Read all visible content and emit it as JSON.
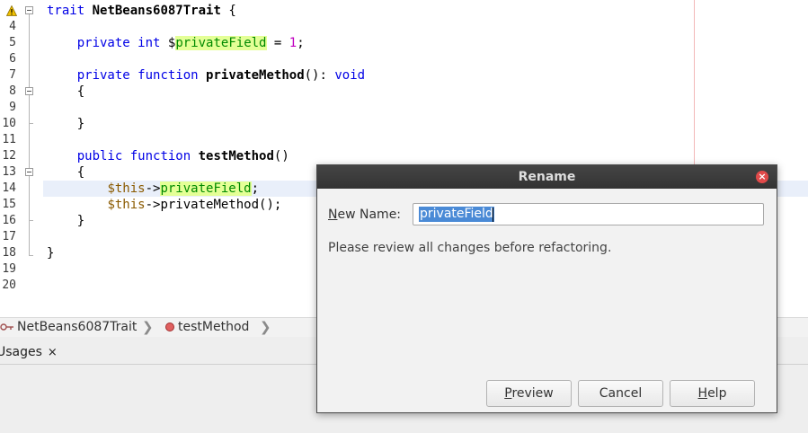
{
  "editor": {
    "line_numbers": [
      "4",
      "5",
      "6",
      "7",
      "8",
      "9",
      "10",
      "11",
      "12",
      "13",
      "14",
      "15",
      "16",
      "17",
      "18",
      "19",
      "20"
    ],
    "code": {
      "l4_kw": "trait",
      "l4_name": "NetBeans6087Trait",
      "l4_brace": "{",
      "l5_private": "private",
      "l5_int": "int",
      "l5_dollar": "$",
      "l5_field": "privateField",
      "l5_eq": " = ",
      "l5_num": "1",
      "l5_semi": ";",
      "l7_private": "private",
      "l7_function": "function",
      "l7_name": "privateMethod",
      "l7_sig": "(): ",
      "l7_void": "void",
      "l8_brace": "{",
      "l10_brace": "}",
      "l12_public": "public",
      "l12_function": "function",
      "l12_name": "testMethod",
      "l12_parens": "()",
      "l13_brace": "{",
      "l14_this": "$this",
      "l14_arrow": "->",
      "l14_field": "privateField",
      "l14_semi": ";",
      "l15_this": "$this",
      "l15_call": "->privateMethod();",
      "l16_brace": "}",
      "l18_brace": "}"
    }
  },
  "breadcrumb": {
    "trait": "NetBeans6087Trait",
    "method": "testMethod",
    "sep": "❯"
  },
  "bottom_panel": {
    "tab_label": "Usages",
    "tab_close": "×"
  },
  "dialog": {
    "title": "Rename",
    "close_glyph": "×",
    "new_name_label_mnemonic": "N",
    "new_name_label_rest": "ew Name:",
    "new_name_value": "privateField",
    "review_text": "Please review all changes before refactoring.",
    "preview_mnemonic": "P",
    "preview_rest": "review",
    "cancel_label": "Cancel",
    "help_mnemonic": "H",
    "help_rest": "elp"
  },
  "icons": [
    "warning-icon",
    "trait-icon",
    "method-icon",
    "close-icon",
    "fold-toggle-icon"
  ],
  "colors": {
    "keyword": "#0000e6",
    "number": "#c000c0",
    "variable": "#8a5a00",
    "field_highlight": "#e4ff96",
    "selection": "#4a8ad6",
    "dialog_titlebar": "#3a3a3a",
    "close_button": "#e14a4a"
  }
}
